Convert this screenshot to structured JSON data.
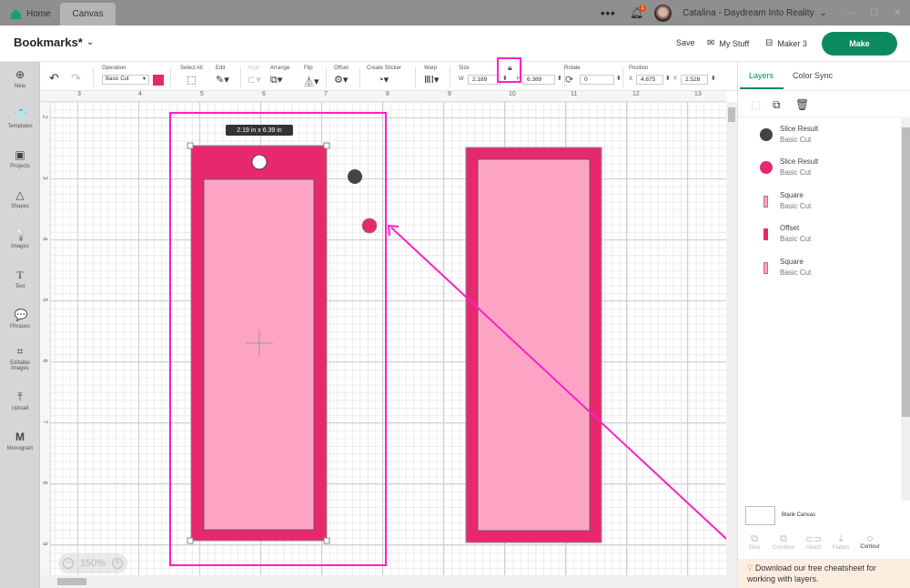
{
  "titlebar": {
    "tabs": [
      {
        "label": "Home"
      },
      {
        "label": "Canvas"
      }
    ],
    "more": "•••",
    "notifications": "1",
    "user": "Catalina - Daydream Into Reality"
  },
  "header": {
    "project_title": "Bookmarks*",
    "save": "Save",
    "my_stuff": "My Stuff",
    "machine": "Maker 3",
    "make": "Make"
  },
  "sidebar": {
    "items": [
      {
        "label": "New",
        "icon": "⊕"
      },
      {
        "label": "Templates",
        "icon": "👕"
      },
      {
        "label": "Projects",
        "icon": "▣"
      },
      {
        "label": "Shapes",
        "icon": "△"
      },
      {
        "label": "Images",
        "icon": "💡"
      },
      {
        "label": "Text",
        "icon": "T"
      },
      {
        "label": "Phrases",
        "icon": "💬"
      },
      {
        "label": "Editable Images",
        "icon": "⌗"
      },
      {
        "label": "Upload",
        "icon": "⤒"
      },
      {
        "label": "Monogram",
        "icon": "M"
      }
    ]
  },
  "toolbar": {
    "undo": "↶",
    "redo": "↷",
    "operation_label": "Operation",
    "operation_value": "Basic Cut",
    "operation_color": "#e8286e",
    "select_all": "Select All",
    "edit": "Edit",
    "align": "Align",
    "arrange": "Arrange",
    "flip": "Flip",
    "offset": "Offset",
    "create_sticker": "Create Sticker",
    "warp": "Warp",
    "size_label": "Size",
    "w_label": "W",
    "w_value": "2.189",
    "h_label": "H",
    "h_value": "6.389",
    "rotate_label": "Rotate",
    "rotate_value": "0",
    "position_label": "Position",
    "x_label": "X",
    "x_value": "4.875",
    "y_label": "Y",
    "y_value": "2.528"
  },
  "canvas": {
    "ruler_top": [
      "3",
      "4",
      "5",
      "6",
      "7",
      "8",
      "9",
      "10",
      "11",
      "12",
      "13"
    ],
    "ruler_left": [
      "2",
      "3",
      "4",
      "5",
      "6",
      "7",
      "8",
      "9"
    ],
    "dimension_tag": "2.19  in x 6.39  in",
    "zoom": "150%",
    "colors": {
      "dark_pink": "#e8286e",
      "light_pink": "#fda4c5",
      "dark_dot": "#444444"
    }
  },
  "panel": {
    "tabs": [
      {
        "label": "Layers"
      },
      {
        "label": "Color Sync"
      }
    ],
    "layers": [
      {
        "name": "Slice Result",
        "operation": "Basic Cut",
        "shape": "circle",
        "color": "#444444"
      },
      {
        "name": "Slice Result",
        "operation": "Basic Cut",
        "shape": "circle",
        "color": "#e8286e"
      },
      {
        "name": "Square",
        "operation": "Basic Cut",
        "shape": "rect",
        "color": "#f7a2c2"
      },
      {
        "name": "Offset",
        "operation": "Basic Cut",
        "shape": "rect",
        "color": "#e8286e"
      },
      {
        "name": "Square",
        "operation": "Basic Cut",
        "shape": "rect",
        "color": "#f7a2c2"
      }
    ],
    "blank_canvas": "Blank Canvas",
    "actions": [
      {
        "label": "Slice",
        "icon": "⧉"
      },
      {
        "label": "Combine",
        "icon": "⧉"
      },
      {
        "label": "Attach",
        "icon": "⊂⊃"
      },
      {
        "label": "Flatten",
        "icon": "⤓"
      },
      {
        "label": "Contour",
        "icon": "◌"
      }
    ],
    "cheatsheet": "Download our free cheatsheet for working with layers."
  }
}
